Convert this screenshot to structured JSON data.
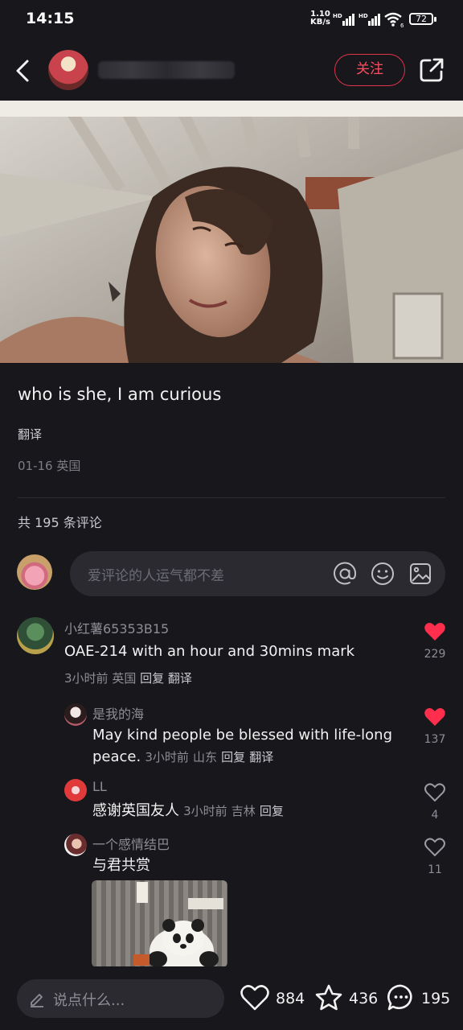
{
  "status_bar": {
    "time": "14:15",
    "net_speed": "1.10",
    "net_unit": "KB/s",
    "signal_1": "HD",
    "signal_2": "HD",
    "wifi_num": "6",
    "battery": "72"
  },
  "header": {
    "follow_label": "关注"
  },
  "post": {
    "title": "who is she, I am curious",
    "translate_label": "翻译",
    "meta": "01-16 英国",
    "comment_count_text": "共 195 条评论",
    "comment_placeholder": "爱评论的人运气都不差"
  },
  "comments": [
    {
      "user": "小红薯65353B15",
      "text": "OAE-214 with an hour and 30mins mark",
      "time": "3小时前",
      "region": "英国",
      "reply": "回复",
      "translate": "翻译",
      "likes": "229",
      "liked": true
    },
    {
      "user": "是我的海",
      "text_line1": "May kind people be blessed with life-long",
      "text_line2": "peace.",
      "time": "3小时前",
      "region": "山东",
      "reply": "回复",
      "translate": "翻译",
      "likes": "137",
      "liked": true
    },
    {
      "user": "LL",
      "text": "感谢英国友人",
      "time": "3小时前",
      "region": "吉林",
      "reply": "回复",
      "likes": "4",
      "liked": false
    },
    {
      "user": "一个感情结巴",
      "text": "与君共赏",
      "likes": "11",
      "liked": false
    }
  ],
  "bottom_bar": {
    "placeholder": "说点什么...",
    "likes": "884",
    "stars": "436",
    "comments": "195"
  },
  "colors": {
    "accent": "#ff2e4d",
    "background": "#17171c"
  },
  "icons": [
    "back-icon",
    "share-icon",
    "at-icon",
    "emoji-icon",
    "image-icon",
    "heart-icon",
    "star-icon",
    "comment-icon",
    "pen-icon"
  ]
}
